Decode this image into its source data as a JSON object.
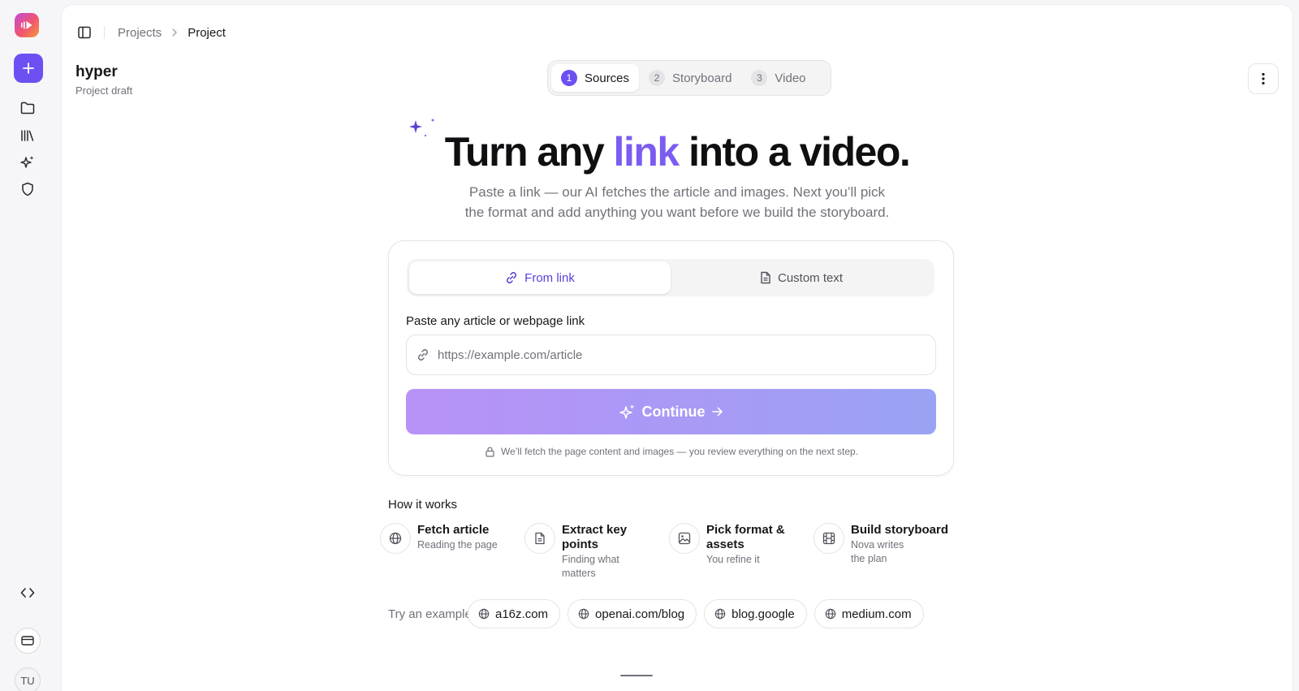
{
  "sidebar": {
    "avatar_initials": "TU"
  },
  "breadcrumb": {
    "items": [
      "Projects",
      "Project"
    ]
  },
  "project": {
    "title": "hyper",
    "subtitle": "Project draft"
  },
  "stepper": {
    "steps": [
      {
        "num": "1",
        "label": "Sources",
        "active": true
      },
      {
        "num": "2",
        "label": "Storyboard",
        "active": false
      },
      {
        "num": "3",
        "label": "Video",
        "active": false
      }
    ]
  },
  "hero": {
    "title_before": "Turn any ",
    "title_accent": "link",
    "title_after": " into a video.",
    "subtitle_line1": "Paste a link — our AI fetches the article and images. Next you’ll pick",
    "subtitle_line2": "the format and add anything you want before we build the storyboard."
  },
  "source_tabs": {
    "from_link": "From link",
    "custom_text": "Custom text",
    "active": "from_link"
  },
  "link_form": {
    "label": "Paste any article or webpage link",
    "placeholder": "https://example.com/article",
    "value": "",
    "continue_label": "Continue",
    "note": "We’ll fetch the page content and images — you review everything on the next step."
  },
  "how_it_works": {
    "title": "How it works",
    "steps": [
      {
        "title": "Fetch article",
        "sub": "Reading the page",
        "icon": "globe-icon"
      },
      {
        "title": "Extract key points",
        "sub": "Finding what matters",
        "icon": "document-icon"
      },
      {
        "title": "Pick format & assets",
        "sub": "You refine it",
        "icon": "image-icon"
      },
      {
        "title": "Build storyboard",
        "sub": "Nova writes the plan",
        "icon": "film-icon"
      }
    ]
  },
  "examples": {
    "label": "Try an example",
    "items": [
      "a16z.com",
      "openai.com/blog",
      "blog.google",
      "medium.com"
    ]
  },
  "colors": {
    "accent": "#7c5cf0",
    "primary_button": "#6d4ff2"
  }
}
